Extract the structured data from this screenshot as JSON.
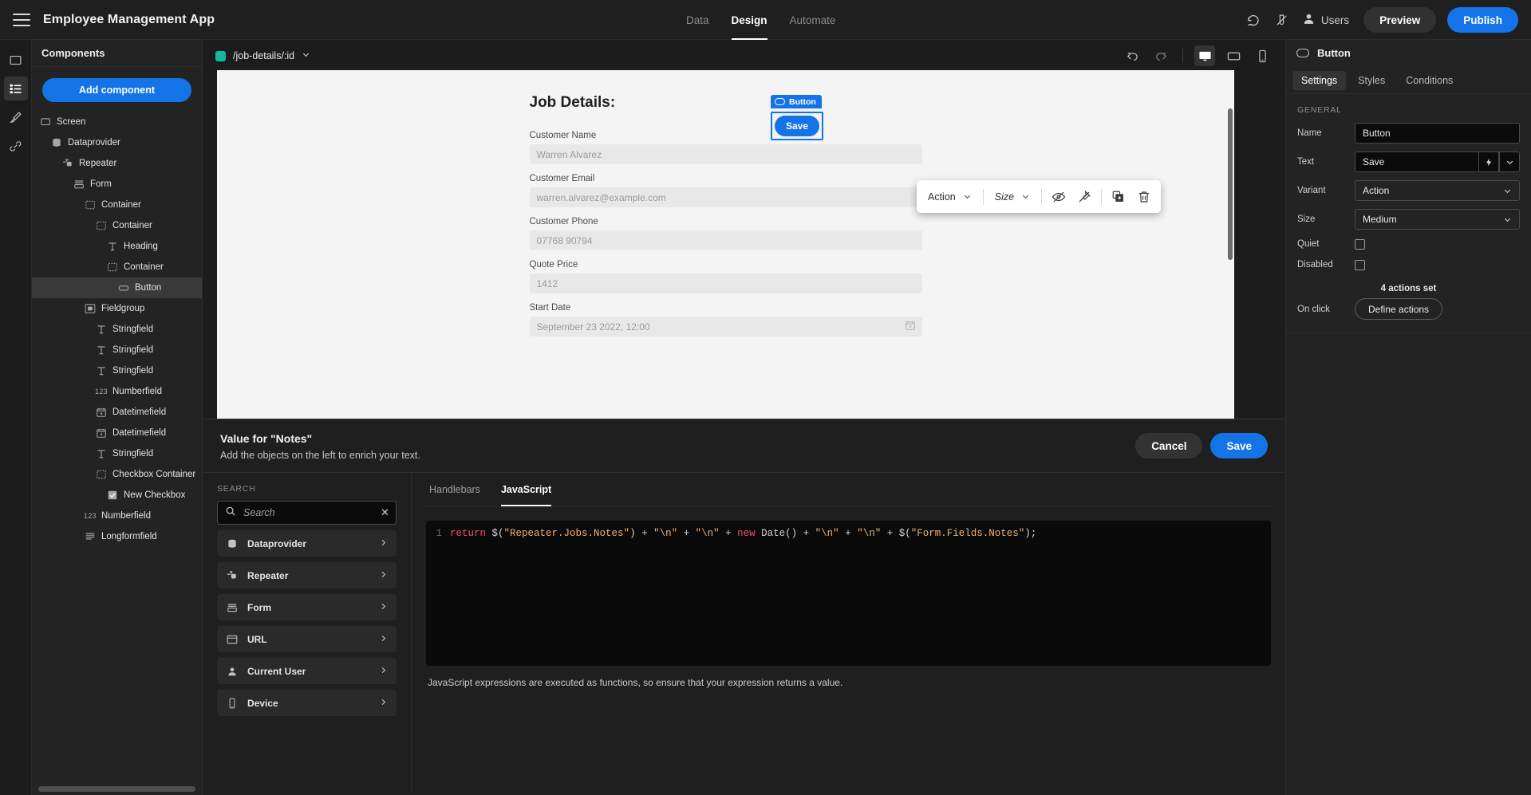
{
  "topbar": {
    "menu_icon": "hamburger-icon",
    "app_title": "Employee Management App",
    "tabs": [
      {
        "label": "Data",
        "active": false
      },
      {
        "label": "Design",
        "active": true
      },
      {
        "label": "Automate",
        "active": false
      }
    ],
    "revert_icon": "revert-icon",
    "theme_icon": "theme-icon",
    "users_icon": "user-icon",
    "users_label": "Users",
    "preview_label": "Preview",
    "publish_label": "Publish",
    "accent_blue": "#1473e6"
  },
  "rail": {
    "items": [
      {
        "icon": "screen-icon",
        "active": false
      },
      {
        "icon": "component-list-icon",
        "active": true
      },
      {
        "icon": "brush-icon",
        "active": false
      },
      {
        "icon": "link-icon",
        "active": false
      }
    ]
  },
  "components_panel": {
    "header": "Components",
    "add_component_label": "Add component",
    "tree": [
      {
        "label": "Screen",
        "icon": "screen-icon",
        "depth": 0,
        "selected": false
      },
      {
        "label": "Dataprovider",
        "icon": "database-icon",
        "depth": 1,
        "selected": false
      },
      {
        "label": "Repeater",
        "icon": "repeater-icon",
        "depth": 2,
        "selected": false
      },
      {
        "label": "Form",
        "icon": "form-icon",
        "depth": 3,
        "selected": false
      },
      {
        "label": "Container",
        "icon": "container-icon",
        "depth": 4,
        "selected": false
      },
      {
        "label": "Container",
        "icon": "container-icon",
        "depth": 5,
        "selected": false
      },
      {
        "label": "Heading",
        "icon": "text-heading-icon",
        "depth": 6,
        "selected": false
      },
      {
        "label": "Container",
        "icon": "container-icon",
        "depth": 6,
        "selected": false
      },
      {
        "label": "Button",
        "icon": "button-pill-icon",
        "depth": 7,
        "selected": true
      },
      {
        "label": "Fieldgroup",
        "icon": "fieldgroup-icon",
        "depth": 4,
        "selected": false
      },
      {
        "label": "Stringfield",
        "icon": "text-heading-icon",
        "depth": 5,
        "selected": false
      },
      {
        "label": "Stringfield",
        "icon": "text-heading-icon",
        "depth": 5,
        "selected": false
      },
      {
        "label": "Stringfield",
        "icon": "text-heading-icon",
        "depth": 5,
        "selected": false
      },
      {
        "label": "Numberfield",
        "icon": "number-123-icon",
        "depth": 5,
        "selected": false
      },
      {
        "label": "Datetimefield",
        "icon": "calendar-icon",
        "depth": 5,
        "selected": false
      },
      {
        "label": "Datetimefield",
        "icon": "calendar-icon",
        "depth": 5,
        "selected": false
      },
      {
        "label": "Stringfield",
        "icon": "text-heading-icon",
        "depth": 5,
        "selected": false
      },
      {
        "label": "Checkbox Container",
        "icon": "container-icon",
        "depth": 5,
        "selected": false
      },
      {
        "label": "New Checkbox",
        "icon": "checkbox-checked-icon",
        "depth": 6,
        "selected": false
      },
      {
        "label": "Numberfield",
        "icon": "number-123-icon",
        "depth": 4,
        "selected": false
      },
      {
        "label": "Longformfield",
        "icon": "longform-icon",
        "depth": 4,
        "selected": false
      }
    ]
  },
  "canvas": {
    "route_label": "/job-details/:id",
    "route_dot_color": "#15b79e",
    "chevron_icon": "chevron-down-icon",
    "undo_icon": "undo-icon",
    "redo_icon": "redo-icon",
    "devices": [
      {
        "icon": "desktop-icon",
        "active": true
      },
      {
        "icon": "tablet-icon",
        "active": false
      },
      {
        "icon": "mobile-icon",
        "active": false
      }
    ],
    "form": {
      "title": "Job Details:",
      "fields": [
        {
          "label": "Customer Name",
          "value": "Warren Alvarez",
          "calendar": false
        },
        {
          "label": "Customer Email",
          "value": "warren.alvarez@example.com",
          "calendar": false
        },
        {
          "label": "Customer Phone",
          "value": "07768 90794",
          "calendar": false
        },
        {
          "label": "Quote Price",
          "value": "1412",
          "calendar": false
        },
        {
          "label": "Start Date",
          "value": "September 23 2022, 12:00",
          "calendar": true
        }
      ]
    },
    "selection": {
      "badge_label": "Button",
      "badge_icon": "button-pill-icon",
      "button_label": "Save"
    },
    "float_toolbar": {
      "variant_label": "Action",
      "size_label": "Size",
      "icons": [
        {
          "name": "eye-off-icon"
        },
        {
          "name": "unpin-icon"
        },
        {
          "name": "duplicate-icon"
        },
        {
          "name": "trash-icon"
        }
      ]
    }
  },
  "right_panel": {
    "title": "Button",
    "title_icon": "button-pill-icon",
    "tabs": [
      {
        "label": "Settings",
        "active": true
      },
      {
        "label": "Styles",
        "active": false
      },
      {
        "label": "Conditions",
        "active": false
      }
    ],
    "section_label": "GENERAL",
    "name_label": "Name",
    "name_value": "Button",
    "text_label": "Text",
    "text_value": "Save",
    "text_binding_icon": "lightning-icon",
    "text_dropdown_icon": "chevron-down-icon",
    "variant_label": "Variant",
    "variant_value": "Action",
    "size_label": "Size",
    "size_value": "Medium",
    "quiet_label": "Quiet",
    "quiet_checked": false,
    "disabled_label": "Disabled",
    "disabled_checked": false,
    "actions_summary": "4 actions set",
    "onclick_label": "On click",
    "define_actions_label": "Define actions"
  },
  "drawer": {
    "title": "Value for \"Notes\"",
    "subtitle": "Add the objects on the left to enrich your text.",
    "cancel_label": "Cancel",
    "save_label": "Save",
    "search_section_label": "SEARCH",
    "search_placeholder": "Search",
    "search_value": "",
    "search_icon": "search-icon",
    "clear_icon": "close-icon",
    "objects": [
      {
        "label": "Dataprovider",
        "icon": "database-icon"
      },
      {
        "label": "Repeater",
        "icon": "repeater-icon"
      },
      {
        "label": "Form",
        "icon": "form-icon"
      },
      {
        "label": "URL",
        "icon": "browser-window-icon"
      },
      {
        "label": "Current User",
        "icon": "user-icon"
      },
      {
        "label": "Device",
        "icon": "mobile-icon"
      }
    ],
    "code_tabs": [
      {
        "label": "Handlebars",
        "active": false
      },
      {
        "label": "JavaScript",
        "active": true
      }
    ],
    "line_number": "1",
    "code_tokens": [
      {
        "t": "return ",
        "c": "kw"
      },
      {
        "t": "$(",
        "c": "pl"
      },
      {
        "t": "\"Repeater.Jobs.Notes\"",
        "c": "str"
      },
      {
        "t": ") + ",
        "c": "pl"
      },
      {
        "t": "\"\\n\"",
        "c": "str"
      },
      {
        "t": " + ",
        "c": "pl"
      },
      {
        "t": "\"\\n\"",
        "c": "str"
      },
      {
        "t": " + ",
        "c": "pl"
      },
      {
        "t": "new ",
        "c": "kw"
      },
      {
        "t": "Date() + ",
        "c": "pl"
      },
      {
        "t": "\"\\n\"",
        "c": "str"
      },
      {
        "t": " + ",
        "c": "pl"
      },
      {
        "t": "\"\\n\"",
        "c": "str"
      },
      {
        "t": " + $(",
        "c": "pl"
      },
      {
        "t": "\"Form.Fields.Notes\"",
        "c": "str"
      },
      {
        "t": ");",
        "c": "pl"
      }
    ],
    "code_hint": "JavaScript expressions are executed as functions, so ensure that your expression returns a value."
  }
}
